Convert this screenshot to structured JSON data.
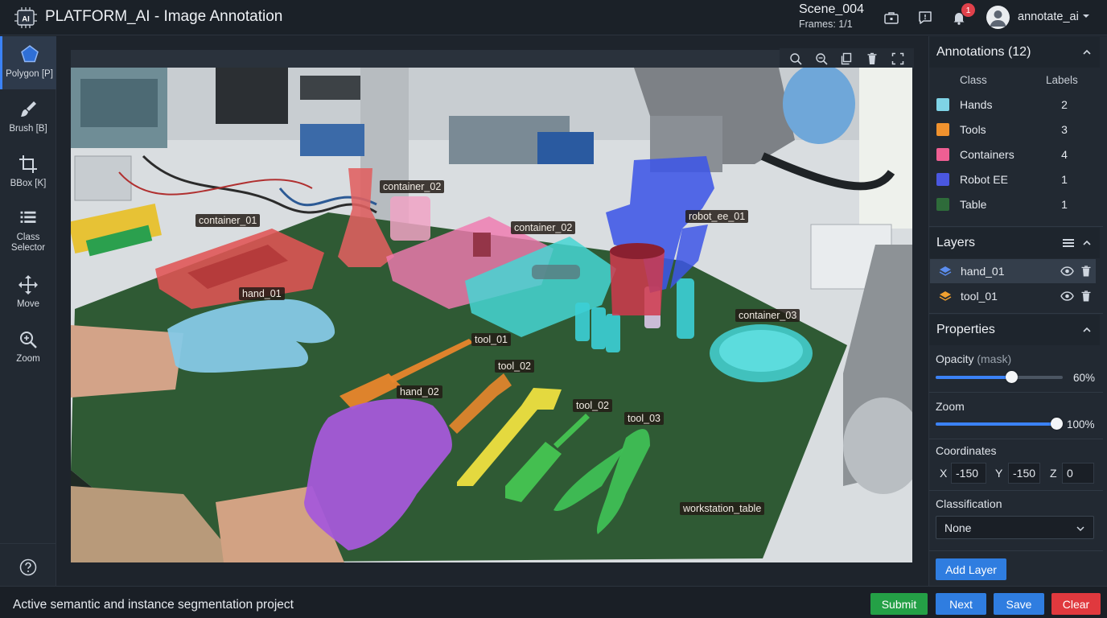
{
  "header": {
    "logo_text": "AI",
    "title": "PLATFORM_AI - Image Annotation",
    "scene_name": "Scene_004",
    "frames": "Frames: 1/1",
    "notification_count": "1",
    "username": "annotate_ai"
  },
  "toolbar": {
    "tools": [
      {
        "label": "Polygon [P]",
        "icon": "pentagon-icon",
        "active": true
      },
      {
        "label": "Brush [B]",
        "icon": "brush-icon",
        "active": false
      },
      {
        "label": "BBox [K]",
        "icon": "crop-icon",
        "active": false
      },
      {
        "label": "Class Selector",
        "icon": "class-list-icon",
        "active": false
      },
      {
        "label": "Move",
        "icon": "move-icon",
        "active": false
      },
      {
        "label": "Zoom",
        "icon": "zoom-icon",
        "active": false
      }
    ]
  },
  "canvas": {
    "labels": {
      "container_01": "container_01",
      "container_02a": "container_02",
      "container_02b": "container_02",
      "container_03": "container_03",
      "robot_ee_01": "robot_ee_01",
      "hand_01": "hand_01",
      "hand_02": "hand_02",
      "tool_01": "tool_01",
      "tool_02a": "tool_02",
      "tool_02b": "tool_02",
      "tool_03": "tool_03",
      "workstation_table": "workstation_table"
    }
  },
  "annotations": {
    "title": "Annotations (12)",
    "col_class": "Class",
    "col_labels": "Labels",
    "rows": [
      {
        "class": "Hands",
        "count": "2",
        "color": "#7fd3e6"
      },
      {
        "class": "Tools",
        "count": "3",
        "color": "#f0922e"
      },
      {
        "class": "Containers",
        "count": "4",
        "color": "#ef5f93"
      },
      {
        "class": "Robot EE",
        "count": "1",
        "color": "#4a57e0"
      },
      {
        "class": "Table",
        "count": "1",
        "color": "#2e6b3a"
      }
    ]
  },
  "layers": {
    "title": "Layers",
    "items": [
      {
        "name": "hand_01",
        "color": "#5b8def",
        "selected": true
      },
      {
        "name": "tool_01",
        "color": "#f0a030",
        "selected": false
      }
    ]
  },
  "properties": {
    "title": "Properties",
    "opacity_label": "Opacity",
    "opacity_suffix": "(mask)",
    "opacity_value": "60%",
    "opacity_fraction": 0.6,
    "zoom_label": "Zoom",
    "zoom_value": "100%",
    "zoom_fraction": 1.0,
    "coordinates_label": "Coordinates",
    "x_label": "X",
    "x_value": "-150",
    "y_label": "Y",
    "y_value": "-150",
    "z_label": "Z",
    "z_value": "0",
    "classification_label": "Classification",
    "classification_value": "None",
    "add_layer": "Add Layer"
  },
  "statusbar": {
    "text": "Active semantic and instance segmentation project",
    "submit": "Submit",
    "next": "Next",
    "save": "Save",
    "clear": "Clear"
  },
  "colors": {
    "accent": "#3b82f6",
    "submit": "#24a046",
    "clear": "#e0393e"
  }
}
